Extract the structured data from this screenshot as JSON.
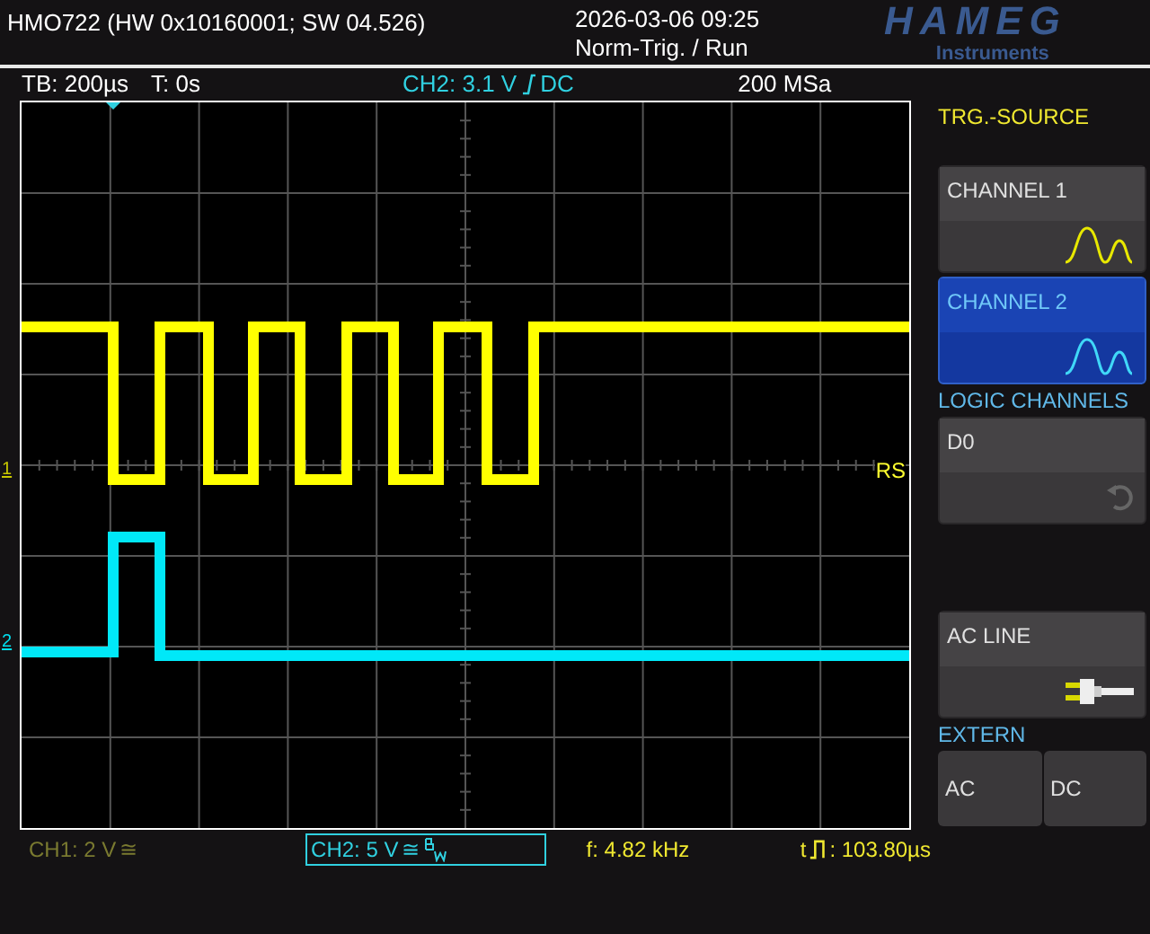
{
  "header": {
    "title": "HMO722 (HW 0x10160001; SW 04.526)",
    "datetime": "2026-03-06 09:25",
    "status": "Norm-Trig. / Run",
    "logo": "HAMEG",
    "logo_sub": "Instruments"
  },
  "info_bar": {
    "timebase": "TB: 200µs",
    "trigger_time": "T: 0s",
    "trigger_level": "CH2: 3.1 V",
    "coupling": "DC",
    "sample_rate": "200 MSa"
  },
  "screen": {
    "markers": [
      {
        "label": "1",
        "color": "#c8c800"
      },
      {
        "label": "2",
        "color": "#00e0f0"
      }
    ],
    "trigger_label": "RS",
    "traces": [
      {
        "color": "#ffff00"
      },
      {
        "color": "#00e8f8"
      }
    ]
  },
  "menu": [
    {
      "kind": "title",
      "label": "TRG.-SOURCE"
    },
    {
      "kind": "wave_option",
      "label": "CHANNEL 1",
      "color": "#e8e800",
      "selected": false
    },
    {
      "kind": "wave_option",
      "label": "CHANNEL 2",
      "color": "#40d8f8",
      "selected": true
    },
    {
      "kind": "section",
      "label": "LOGIC CHANNELS"
    },
    {
      "kind": "logic_option",
      "label": "D0",
      "selected": false
    },
    {
      "kind": "gap"
    },
    {
      "kind": "line_option",
      "label": "AC LINE",
      "selected": false
    },
    {
      "kind": "section",
      "label": "EXTERN"
    },
    {
      "kind": "pair",
      "labels": [
        "AC",
        "DC"
      ]
    }
  ],
  "status_bar": {
    "ch1": {
      "label": "CH1: 2 V",
      "symbol": "≅",
      "selected": false
    },
    "ch2": {
      "label": "CH2: 5 V",
      "symbol": "≅",
      "selected": true
    },
    "frequency": "f: 4.82 kHz",
    "pulse_prefix": "t",
    "pulse_width": ": 103.80µs"
  }
}
